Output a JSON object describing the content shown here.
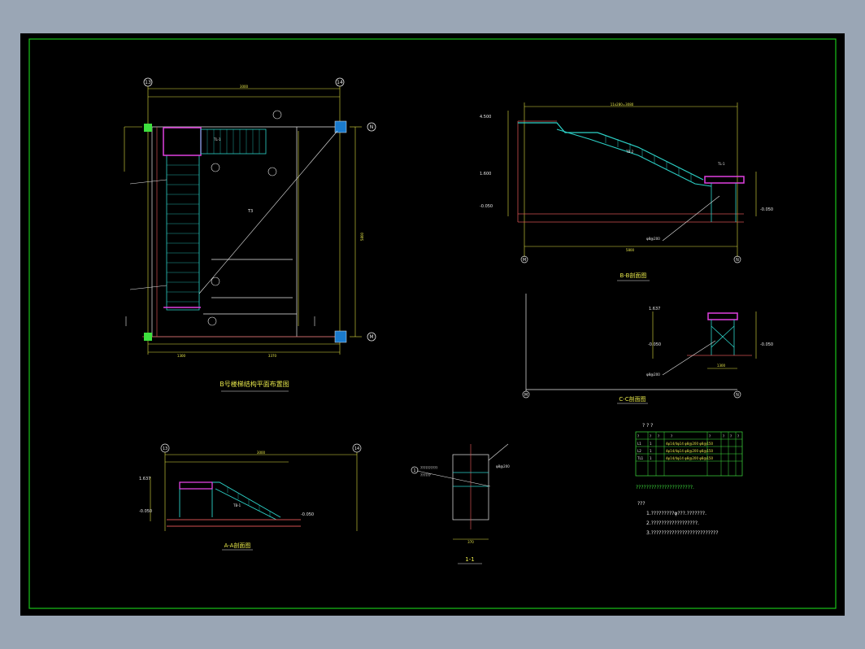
{
  "colors": {
    "window": "#9aa6b5",
    "paper": "#000000",
    "frame": "#19c319",
    "dim": "#e0e040",
    "stair": "#2cd2c8",
    "beam": "#e040e0",
    "wall": "#d05050",
    "text": "#e6e6e6",
    "column": "#1a7acc"
  },
  "plan": {
    "title": "B号楼梯结构平面布置图",
    "axis_labels": [
      "13",
      "14",
      "N",
      "M"
    ],
    "top_dim": "3000",
    "right_dim": "5800",
    "bottom_dim_1": "1300",
    "bottom_dim_2": "3370",
    "tl_label": "TL-1",
    "room_label": "T3"
  },
  "section_bb": {
    "title": "B-B剖面图",
    "axis_labels": [
      "M",
      "N"
    ],
    "elev_top": "4.500",
    "elev_mid": "1.600",
    "elev_low": "-0.050",
    "elev_right": "-0.050",
    "tl_label": "TL-1",
    "slab_label": "TB-2",
    "bottom_dim": "5800",
    "top_dim_label": "11x280=3080",
    "rebar_label": "φ8@200"
  },
  "section_cc": {
    "title": "C-C剖面图",
    "axis_labels": [
      "M",
      "N"
    ],
    "elev_top": "1.637",
    "elev_left": "-0.050",
    "elev_right": "-0.050",
    "rebar_label": "φ8@200",
    "bottom_dim": "1300"
  },
  "section_aa": {
    "title": "A-A剖面图",
    "axis_labels": [
      "13",
      "14"
    ],
    "top_dim": "3000",
    "elev_left": "1.637",
    "elev_low": "-0.050",
    "elev_right": "-0.050",
    "slab_label": "TB-1"
  },
  "section_11": {
    "title": "1-1",
    "marker": "1",
    "note_a": "??????????",
    "note_b": "??????",
    "rebar_label": "φ8@200",
    "bottom_dim": "370"
  },
  "schedule": {
    "title": "? ? ?",
    "headers": [
      "?",
      "?",
      "?",
      "?",
      "?",
      "?",
      "?",
      "?"
    ],
    "rows": [
      [
        "L1",
        "1",
        "4φ14/4φ14 φ8@200 φ8@150",
        "",
        "",
        ""
      ],
      [
        "L2",
        "1",
        "4φ14/4φ14 φ8@200 φ8@150",
        "",
        "",
        ""
      ],
      [
        "TL1",
        "1",
        "4φ14/4φ14 φ8@200 φ8@150",
        "",
        "",
        ""
      ]
    ],
    "note": "??????????????????????.",
    "notes_title": "???",
    "notes": [
      "1.?????????φ???.???????.",
      "2.??????????????????.",
      "3.??????????????????????????"
    ]
  }
}
